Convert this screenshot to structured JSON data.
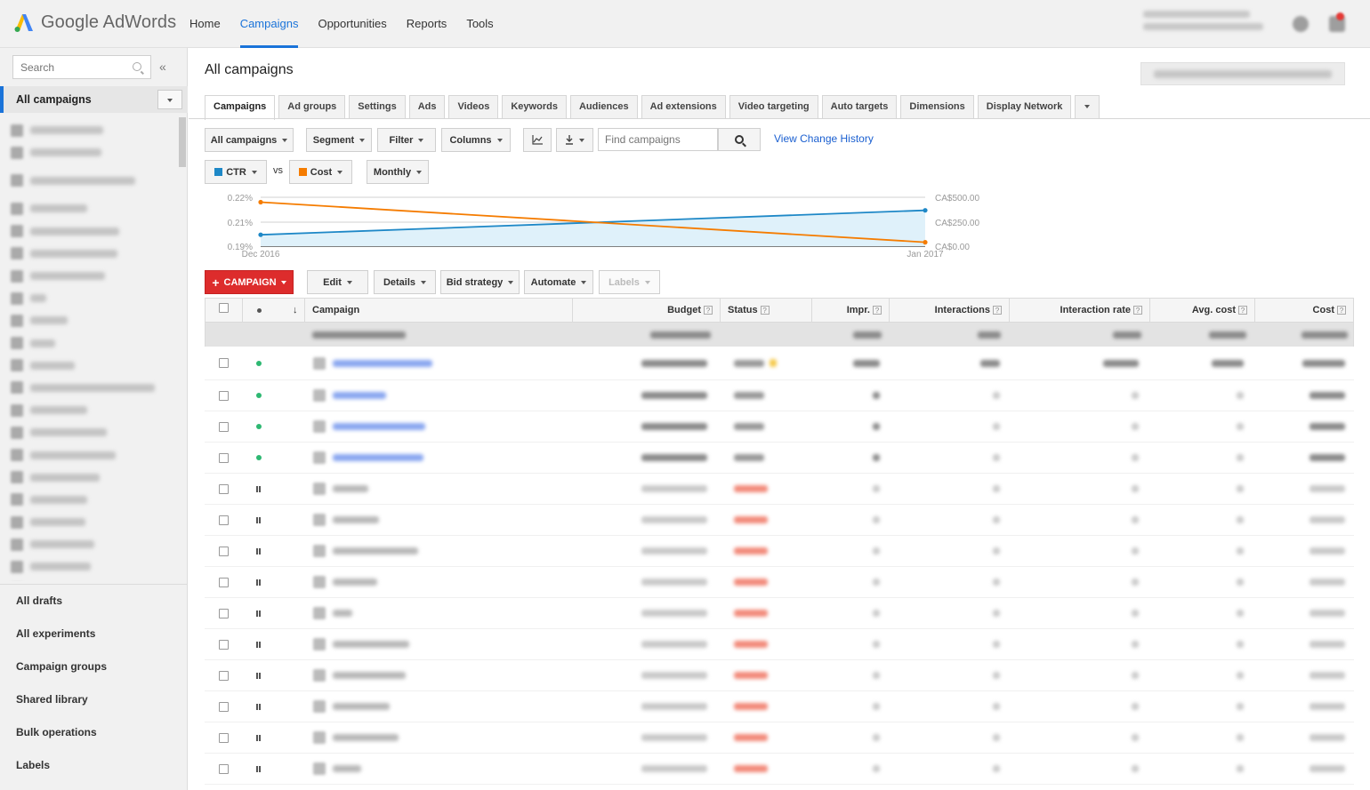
{
  "app": {
    "name": "Google AdWords"
  },
  "nav": {
    "items": [
      {
        "label": "Home"
      },
      {
        "label": "Campaigns",
        "active": true
      },
      {
        "label": "Opportunities"
      },
      {
        "label": "Reports"
      },
      {
        "label": "Tools"
      }
    ]
  },
  "sidebar": {
    "search_placeholder": "Search",
    "collapse_glyph": "«",
    "all_campaigns": "All campaigns",
    "links": [
      "All drafts",
      "All experiments",
      "Campaign groups",
      "Shared library",
      "Bulk operations",
      "Labels"
    ]
  },
  "page": {
    "title": "All campaigns"
  },
  "tabs": [
    "Campaigns",
    "Ad groups",
    "Settings",
    "Ads",
    "Videos",
    "Keywords",
    "Audiences",
    "Ad extensions",
    "Video targeting",
    "Auto targets",
    "Dimensions",
    "Display Network"
  ],
  "toolbar": {
    "all_campaigns": "All campaigns",
    "segment": "Segment",
    "filter": "Filter",
    "columns": "Columns",
    "find_placeholder": "Find campaigns",
    "view_change_history": "View Change History"
  },
  "chart_controls": {
    "metric1": "CTR",
    "metric1_color": "#1e88c7",
    "vs": "vs",
    "metric2": "Cost",
    "metric2_color": "#f57c00",
    "period": "Monthly"
  },
  "chart_data": {
    "type": "line",
    "x": [
      "Dec 2016",
      "Jan 2017"
    ],
    "left_axis_ticks": [
      "0.22%",
      "0.21%",
      "0.19%"
    ],
    "right_axis_ticks": [
      "CA$500.00",
      "CA$250.00",
      "CA$0.00"
    ],
    "series": [
      {
        "name": "CTR",
        "axis": "left",
        "values": [
          0.197,
          0.212
        ],
        "color": "#1e88c7",
        "fill": "#dff1fa"
      },
      {
        "name": "Cost",
        "axis": "right",
        "values": [
          450,
          40
        ],
        "color": "#f57c00"
      }
    ],
    "left_ylim": [
      0.19,
      0.22
    ],
    "right_ylim": [
      0,
      500
    ]
  },
  "action_bar": {
    "campaign": "CAMPAIGN",
    "edit": "Edit",
    "details": "Details",
    "bid_strategy": "Bid strategy",
    "automate": "Automate",
    "labels": "Labels"
  },
  "table": {
    "columns": [
      "Campaign",
      "Budget",
      "Status",
      "Impr.",
      "Interactions",
      "Interaction rate",
      "Avg. cost",
      "Cost"
    ],
    "help_glyph": "?",
    "rows": [
      {
        "state": "enabled"
      },
      {
        "state": "enabled"
      },
      {
        "state": "enabled"
      },
      {
        "state": "enabled"
      },
      {
        "state": "paused"
      },
      {
        "state": "paused"
      },
      {
        "state": "paused"
      },
      {
        "state": "paused"
      },
      {
        "state": "paused"
      },
      {
        "state": "paused"
      },
      {
        "state": "paused"
      },
      {
        "state": "paused"
      },
      {
        "state": "paused"
      },
      {
        "state": "paused"
      }
    ]
  },
  "colors": {
    "brand_blue": "#1a73d9",
    "campaign_red": "#dd2c2c",
    "status_green": "#2eb872"
  }
}
